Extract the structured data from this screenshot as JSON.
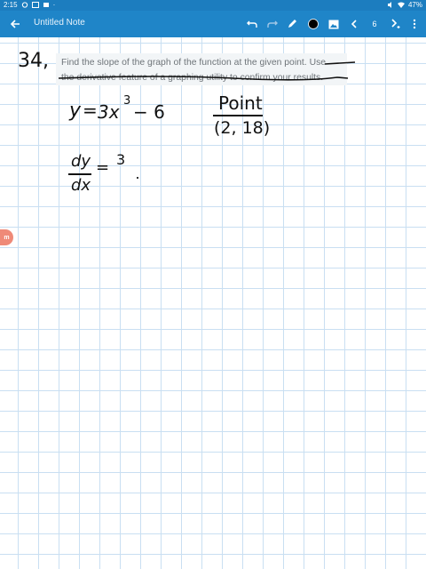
{
  "status_bar": {
    "time": "2:15",
    "battery": "47%"
  },
  "toolbar": {
    "title": "Untitled Note",
    "page_number": "6",
    "icons": [
      "back-arrow-icon",
      "undo-icon",
      "redo-icon",
      "pen-icon",
      "color-circle-icon",
      "image-icon",
      "prev-page-icon",
      "next-page-icon",
      "more-icon"
    ]
  },
  "note": {
    "problem_number": "34,",
    "question_line1": "Find the slope of the graph of the function at the given point. Use",
    "question_line2": "the derivative feature of a graphing utility to confirm your results.",
    "equation_lhs": "y",
    "equation_eq": "=",
    "equation_coef": "3x",
    "equation_exp": "3",
    "equation_rest": "− 6",
    "point_label": "Point",
    "point_value": "(2, 18)",
    "deriv_num": "dy",
    "deriv_den": "dx",
    "deriv_eq": "=",
    "deriv_val": "3"
  },
  "side_tab": {
    "label": "m"
  },
  "colors": {
    "statusbar": "#1c7dbf",
    "appbar": "#1f85c8",
    "grid": "#c9dff2",
    "ink": "#111111",
    "question_bg": "#f2f5f7",
    "side_tab": "#ef8a78"
  }
}
